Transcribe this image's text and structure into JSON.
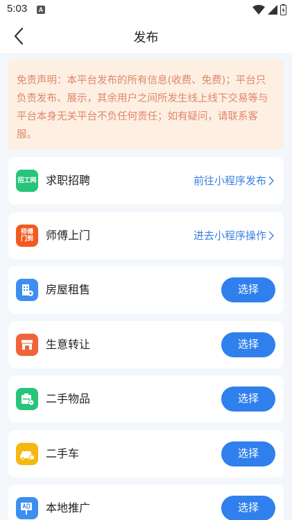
{
  "status_bar": {
    "time": "5:03",
    "notification_letter": "A"
  },
  "header": {
    "title": "发布"
  },
  "disclaimer": {
    "text": "免责声明：本平台发布的所有信息(收费、免费)；平台只负责发布、展示，其余用户之间所发生线上线下交易等与平台本身无关平台不负任何责任；如有疑问，请联系客服。"
  },
  "items": [
    {
      "label": "求职招聘",
      "action": "前往小程序发布",
      "icon": "recruit-icon",
      "icon_text": "招工网",
      "color": "#27c47a"
    },
    {
      "label": "师傅上门",
      "action": "进去小程序操作",
      "icon": "master-home-icon",
      "icon_text": "师傅\n门到",
      "color": "#f25a1f"
    },
    {
      "label": "房屋租售",
      "action": "选择",
      "icon": "building-icon",
      "color": "#3d8ef0"
    },
    {
      "label": "生意转让",
      "action": "选择",
      "icon": "shop-icon",
      "color": "#f0643c"
    },
    {
      "label": "二手物品",
      "action": "选择",
      "icon": "secondhand-goods-icon",
      "color": "#27c47a"
    },
    {
      "label": "二手车",
      "action": "选择",
      "icon": "car-icon",
      "color": "#f5b80f"
    },
    {
      "label": "本地推广",
      "action": "选择",
      "icon": "ad-icon",
      "color": "#3d8ef0"
    }
  ]
}
